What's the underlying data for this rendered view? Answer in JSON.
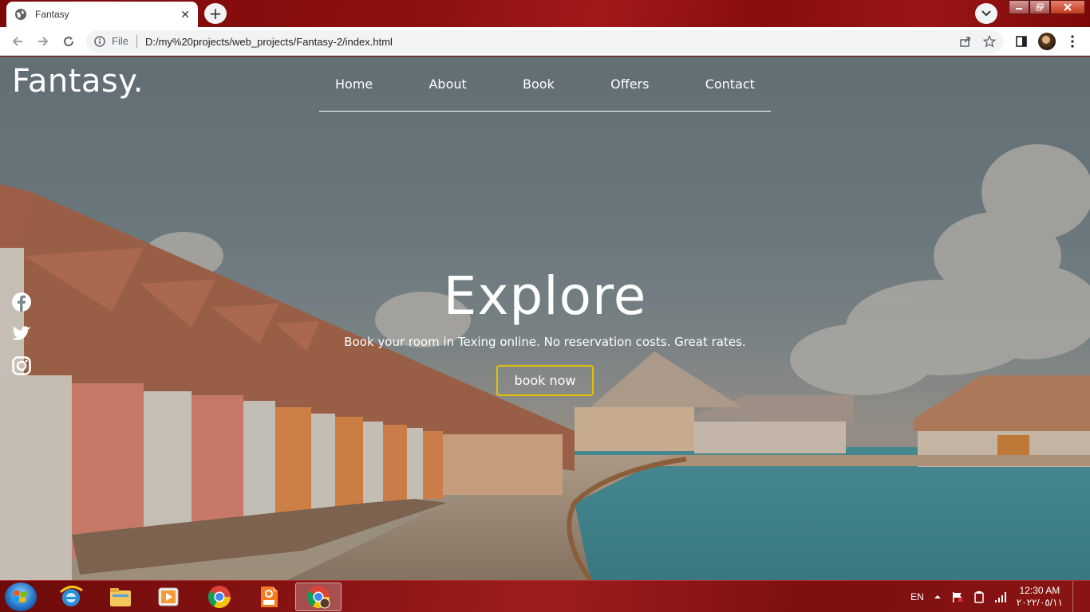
{
  "browser": {
    "tab_title": "Fantasy",
    "tab_close": "✕",
    "new_tab": "+",
    "address_chip": "File",
    "url": "D:/my%20projects/web_projects/Fantasy-2/index.html"
  },
  "site": {
    "logo": "Fantasy.",
    "nav": [
      "Home",
      "About",
      "Book",
      "Offers",
      "Contact"
    ],
    "hero_title": "Explore",
    "hero_subtitle": "Book your room in Texing online. No reservation costs. Great rates.",
    "cta_label": "book now",
    "social": [
      "facebook-icon",
      "twitter-icon",
      "instagram-icon"
    ]
  },
  "taskbar": {
    "apps": [
      "internet-explorer-icon",
      "file-explorer-icon",
      "media-player-icon",
      "chrome-icon",
      "pdf-reader-icon",
      "chrome-active-icon"
    ],
    "language": "EN",
    "time": "12:30 AM",
    "date": "٢٠٢٢/٠٥/١١"
  },
  "colors": {
    "cta_border": "#e6c000",
    "chrome_frame": "#8a1414"
  }
}
